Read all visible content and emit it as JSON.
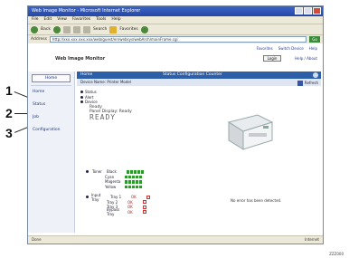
{
  "callouts": [
    "1",
    "2",
    "3"
  ],
  "browser": {
    "title": "Web Image Monitor - Microsoft Internet Explorer",
    "menu": [
      "File",
      "Edit",
      "View",
      "Favorites",
      "Tools",
      "Help"
    ],
    "toolbar": {
      "back": "Back",
      "search": "Search",
      "favorites": "Favorites"
    },
    "address_label": "Address",
    "address": "http://xxx.xxx.xxx.xxx/web/guest/en/websys/webArch/mainFrame.cgi",
    "go": "Go",
    "status": "Done",
    "zone": "Internet"
  },
  "page": {
    "header_links": [
      "Favorites",
      "Switch Device",
      "Help"
    ],
    "brand": "Web Image Monitor",
    "logout": "Login",
    "help": "Help / About",
    "sidebar": {
      "home": "Home",
      "items": [
        "Home",
        "Status",
        "Job",
        "Configuration"
      ]
    },
    "main": {
      "title": "Home",
      "center": "Status  Configuration  Counter",
      "subbar": "Device Name: Printer Model",
      "refresh": "Refresh",
      "status_lines": [
        "Status",
        "Alert",
        "Device"
      ],
      "message_label": "Ready",
      "message_sub": "Panel Display: Ready",
      "big_message": "READY",
      "toner_label": "Toner",
      "toner": [
        {
          "name": "Black",
          "level": 1.0
        },
        {
          "name": "Cyan",
          "level": 1.0
        },
        {
          "name": "Magenta",
          "level": 1.0
        },
        {
          "name": "Yellow",
          "level": 1.0
        }
      ],
      "tray_label": "Input Tray",
      "trays": [
        {
          "name": "Tray 1",
          "status": "OK"
        },
        {
          "name": "Tray 2",
          "status": "OK"
        },
        {
          "name": "Tray 3",
          "status": "OK"
        },
        {
          "name": "Bypass Tray",
          "status": "OK"
        }
      ],
      "side_note": "No error has been detected."
    }
  },
  "footer_code": "ZZZ000"
}
